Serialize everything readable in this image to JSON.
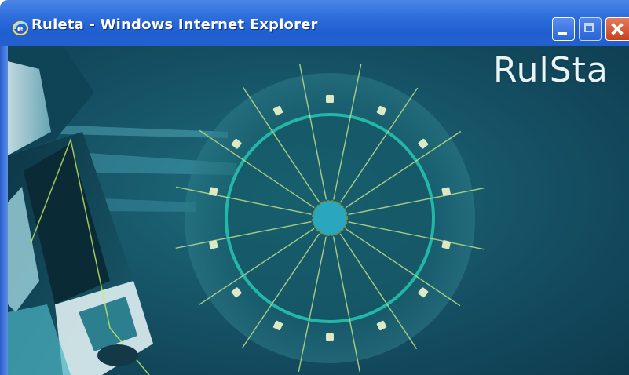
{
  "window": {
    "title": "Ruleta - Windows Internet Explorer",
    "controls": {
      "minimize": "minimize",
      "maximize": "maximize",
      "close": "close"
    }
  },
  "game": {
    "logo_text": "RulSta",
    "wheel": {
      "spokes": 16,
      "markers": 14,
      "accent_color": "#22b7a7",
      "hub_color": "#2aa6bf"
    },
    "background": "#154f63"
  },
  "icons": {
    "app": "internet-explorer-icon"
  }
}
